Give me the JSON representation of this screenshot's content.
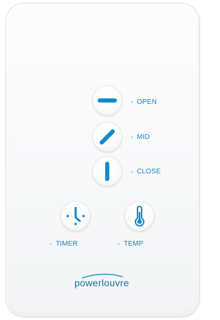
{
  "controls": {
    "open_label": "OPEN",
    "mid_label": "MID",
    "close_label": "CLOSE",
    "timer_label": "TIMER",
    "temp_label": "TEMP"
  },
  "icons": {
    "open": "horizontal-bar-icon",
    "mid": "diagonal-bar-icon",
    "close": "vertical-bar-icon",
    "timer": "clock-icon",
    "temp": "thermometer-icon"
  },
  "brand": {
    "name": "powerlouvre"
  },
  "colors": {
    "accent": "#0f8ac7",
    "label": "#1f7fb4",
    "panel": "#f9fafb"
  }
}
